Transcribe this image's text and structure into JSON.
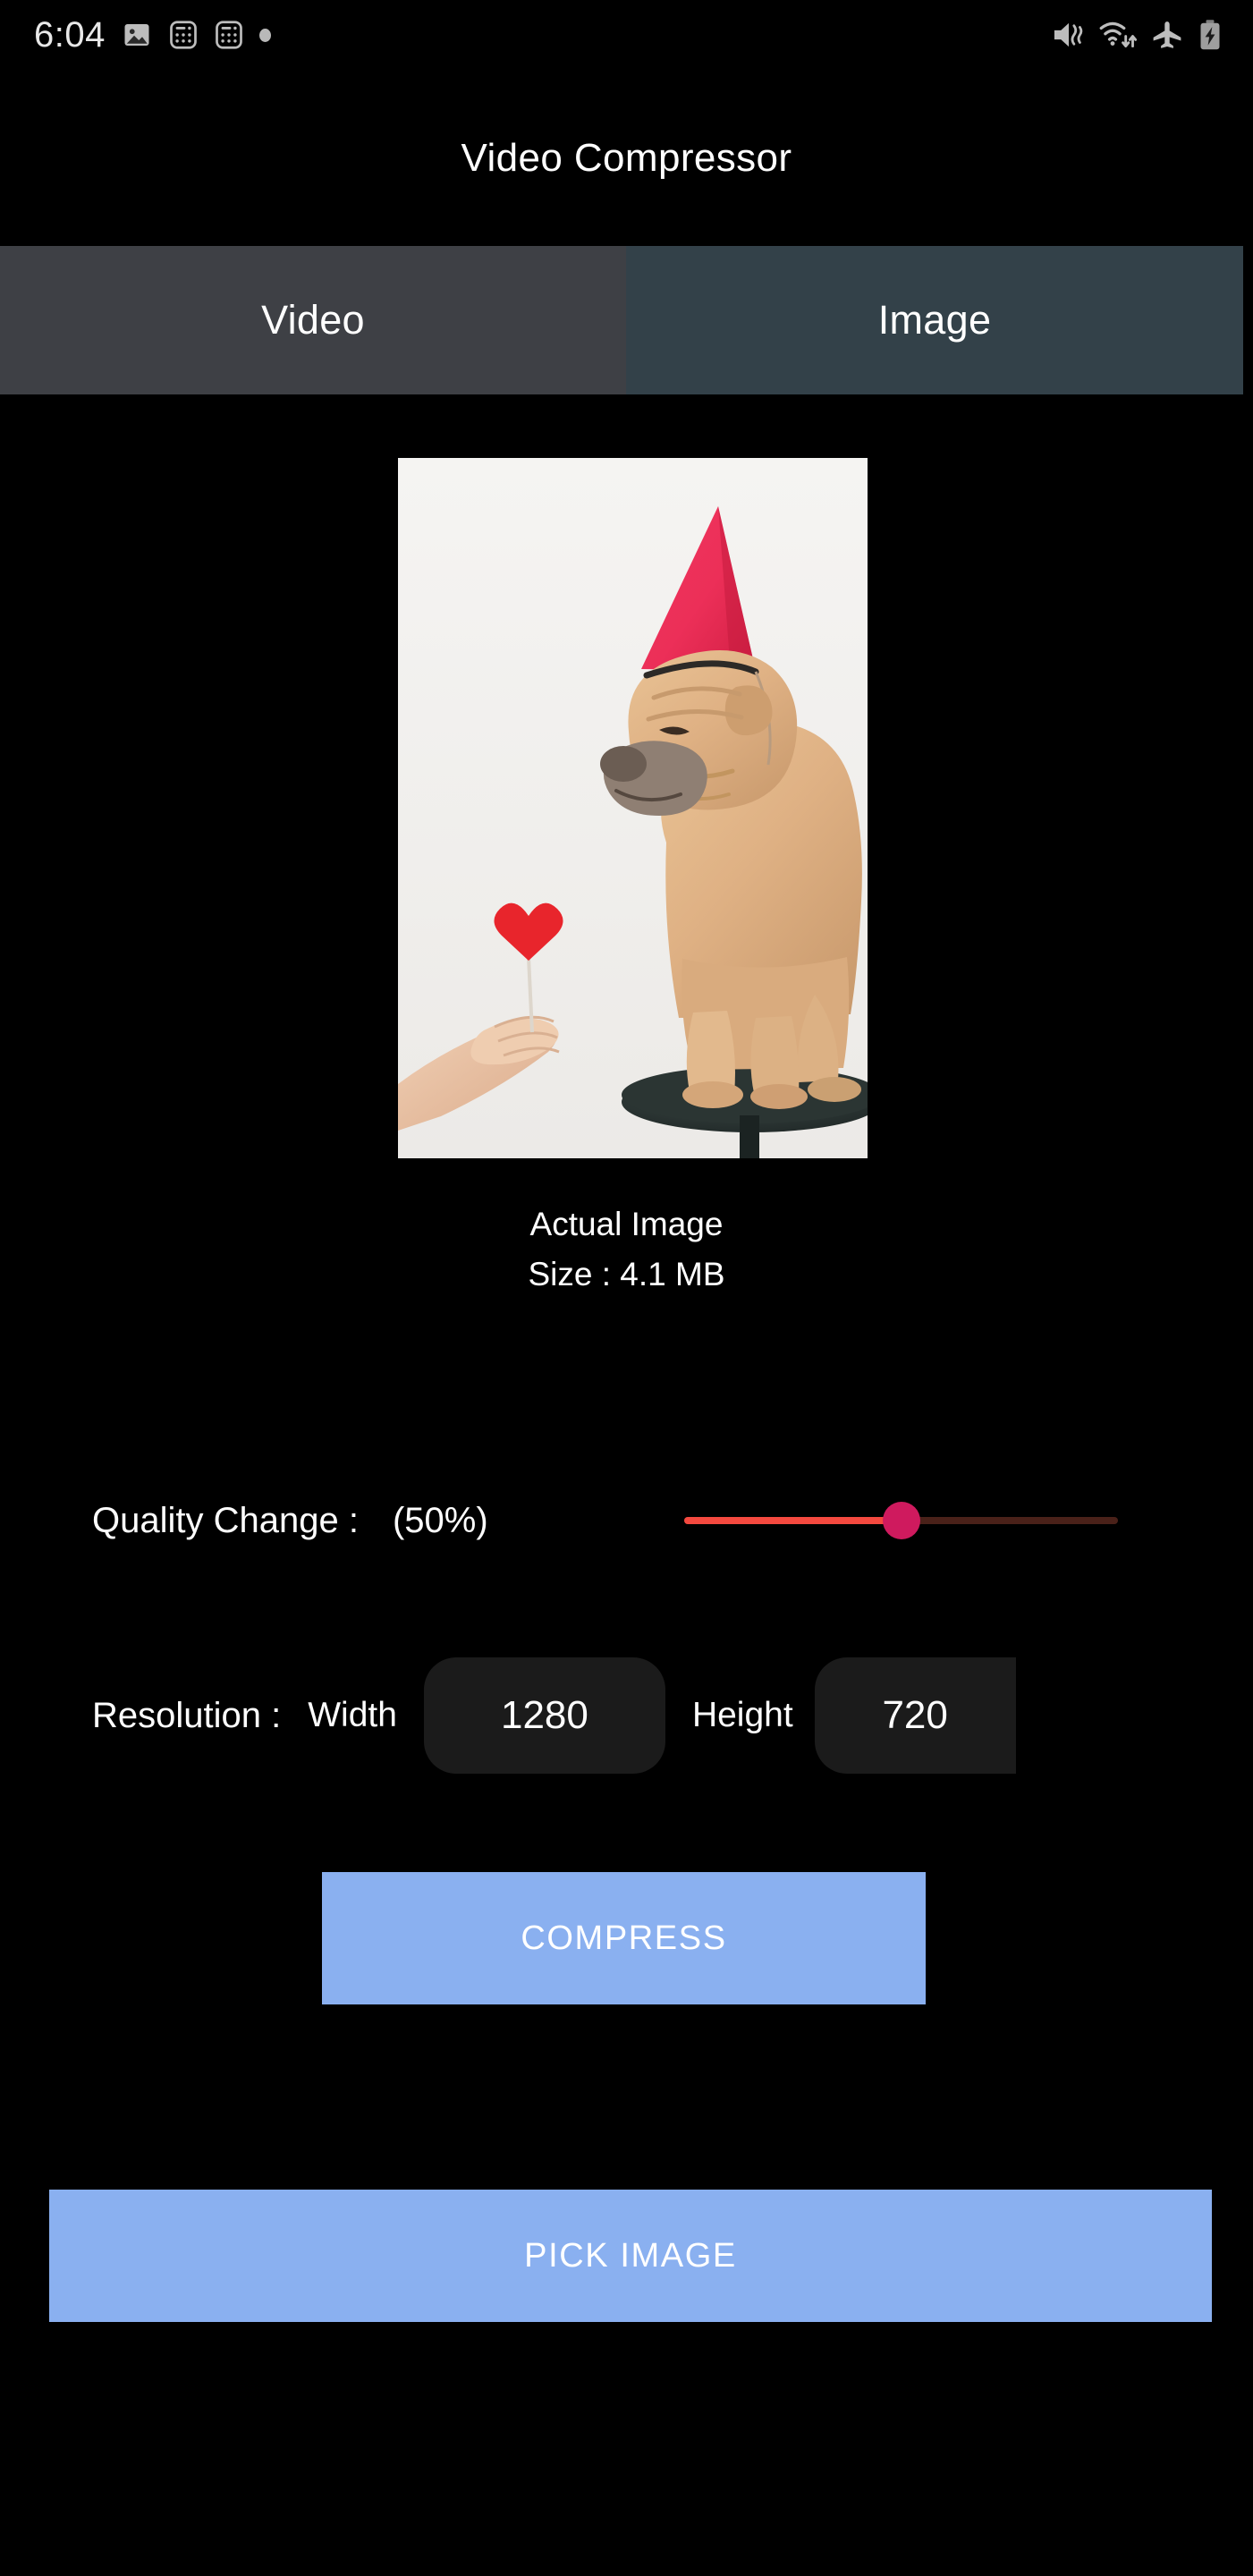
{
  "statusbar": {
    "time": "6:04",
    "left_icons": [
      "photo-icon",
      "calculator-icon",
      "calculator-icon",
      "dot-icon"
    ],
    "right_icons": [
      "vibrate-mute-icon",
      "wifi-icon",
      "airplane-mode-icon",
      "battery-charging-icon"
    ]
  },
  "appbar": {
    "title": "Video Compressor"
  },
  "tabs": [
    {
      "label": "Video",
      "selected": false,
      "color": "#3e4045"
    },
    {
      "label": "Image",
      "selected": true,
      "color": "#334149"
    }
  ],
  "preview": {
    "alt": "Shar Pei puppy wearing a pink party hat sitting on a dark stool while a hand offers a red felt heart on a stick",
    "caption_title": "Actual Image",
    "caption_size": "Size : 4.1 MB"
  },
  "quality": {
    "label": "Quality Change :",
    "value_text": "(50%)",
    "percent": 50,
    "active_color": "#f4493f",
    "inactive_color": "#4a2119",
    "thumb_color": "#cf1a5e"
  },
  "resolution": {
    "label": "Resolution :",
    "width_label": "Width",
    "width_value": "1280",
    "height_label": "Height",
    "height_value": "720"
  },
  "buttons": {
    "compress": "COMPRESS",
    "pick_image": "PICK IMAGE",
    "accent_color": "#8ab0f0"
  }
}
